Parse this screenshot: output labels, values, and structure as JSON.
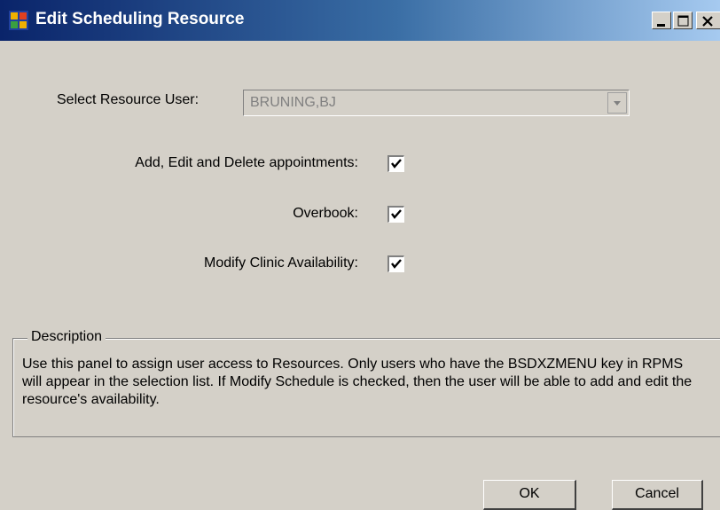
{
  "window": {
    "title": "Edit Scheduling Resource",
    "icon": "app-window-icon",
    "controls": [
      "minimize-icon",
      "maximize-icon",
      "close-icon"
    ]
  },
  "form": {
    "resource_user_label": "Select Resource User:",
    "resource_user_value": "BRUNING,BJ",
    "add_edit_delete_label": "Add, Edit and Delete appointments:",
    "add_edit_delete_checked": true,
    "overbook_label": "Overbook:",
    "overbook_checked": true,
    "modify_availability_label": "Modify Clinic Availability:",
    "modify_availability_checked": true
  },
  "description": {
    "legend": "Description",
    "text": "Use this panel to assign user access to Resources.  Only users who have the BSDXZMENU key in RPMS will appear in the selection list.  If Modify Schedule is checked, then the user will be able to add and edit the resource's availability."
  },
  "buttons": {
    "ok": "OK",
    "cancel": "Cancel"
  },
  "colors": {
    "face": "#d4d0c8",
    "title_start": "#0a246a",
    "title_end": "#a6caf0"
  }
}
